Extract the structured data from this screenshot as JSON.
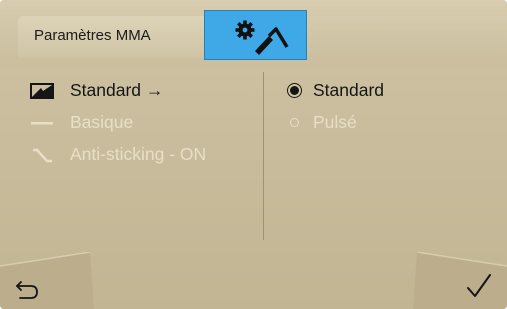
{
  "tabs": [
    {
      "label": "Paramètres MMA"
    },
    {
      "icon": "gear-electrode-icon"
    },
    {
      "label": ""
    }
  ],
  "left_menu": {
    "items": [
      {
        "icon": "waveform-standard-icon",
        "label": "Standard →",
        "state": "active"
      },
      {
        "icon": "flat-line-icon",
        "label": "Basique",
        "state": "disabled"
      },
      {
        "icon": "anti-sticking-icon",
        "label": "Anti-sticking - ON",
        "state": "disabled"
      }
    ]
  },
  "right_menu": {
    "options": [
      {
        "label": "Standard",
        "selected": true
      },
      {
        "label": "Pulsé",
        "selected": false
      }
    ]
  },
  "footer": {
    "back_icon": "undo-arrow-icon",
    "confirm_icon": "checkmark-icon"
  },
  "colors": {
    "background": "#c9bd9d",
    "active_tab": "#3fa8e6",
    "text": "#151515",
    "disabled_text": "#e8dfc7"
  }
}
